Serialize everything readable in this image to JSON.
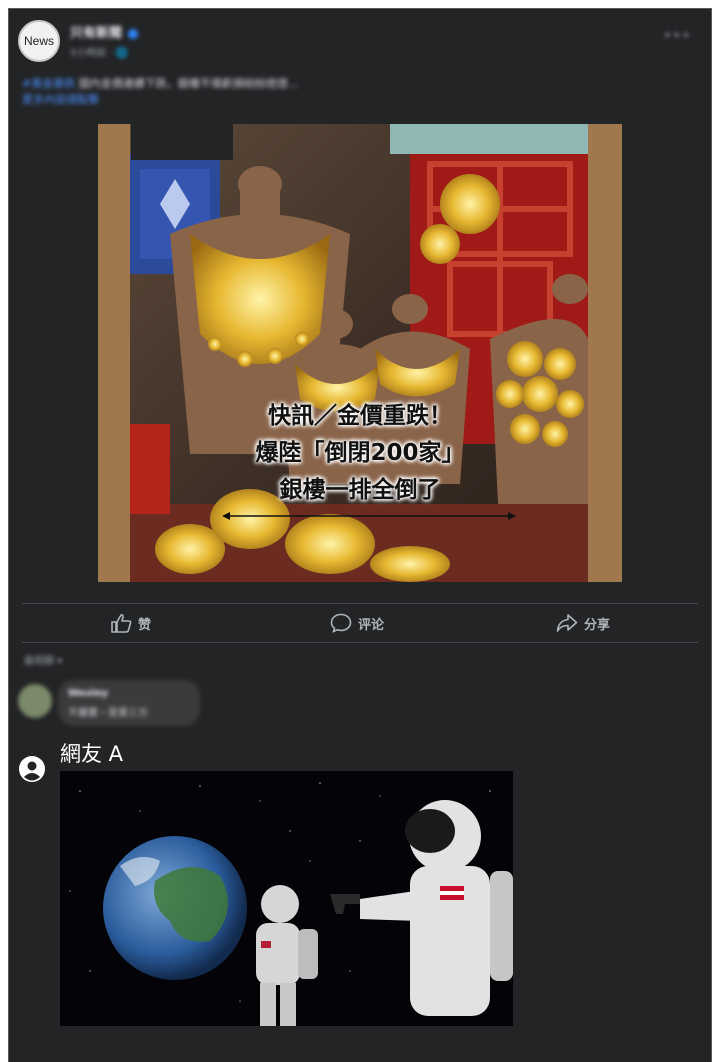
{
  "post": {
    "avatar_label": "News",
    "page_name": "只有新聞",
    "meta": "5小時前 · 🌐",
    "more": "•••",
    "text_blue": "#黃金暴跌",
    "text": " 國內金價連續下跌，銀樓不堪虧損紛紛熄燈…",
    "text_link": "更多內容請點擊"
  },
  "image": {
    "caption_lines": [
      "快訊／金價重跌！",
      "爆陸「倒閉200家」",
      "銀樓一排全倒了"
    ]
  },
  "actions": {
    "like": "赞",
    "comment": "评论",
    "share": "分享"
  },
  "comments": {
    "sort_label": "最相關 ▾",
    "first": {
      "name": "Wesley",
      "text": "不屬實・是第三方"
    },
    "reply": {
      "name": "網友 A"
    }
  },
  "colors": {
    "background": "#232426",
    "text_primary": "#e4e6eb",
    "text_secondary": "#b0b3b8",
    "link": "#4a90ff"
  }
}
